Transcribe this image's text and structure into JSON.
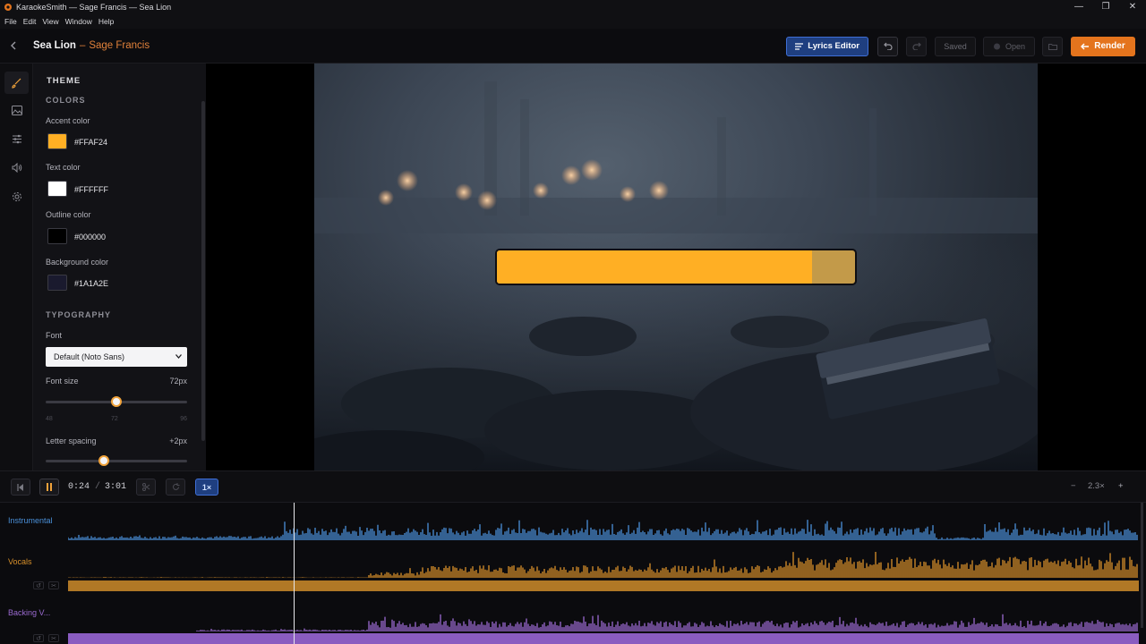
{
  "window": {
    "title": "KaraokeSmith — Sage Francis — Sea Lion",
    "controls": [
      "—",
      "❐",
      "✕"
    ]
  },
  "menu": [
    "File",
    "Edit",
    "View",
    "Window",
    "Help"
  ],
  "header": {
    "song_title": "Sea Lion",
    "separator": "–",
    "artist": "Sage Francis",
    "lyrics_editor_label": "Lyrics Editor",
    "saved_label": "Saved",
    "open_label": "Open",
    "render_label": "Render"
  },
  "theme_panel": {
    "title": "THEME",
    "colors_title": "COLORS",
    "accent_label": "Accent color",
    "accent_value": "#FFAF24",
    "text_label": "Text color",
    "text_value": "#FFFFFF",
    "outline_label": "Outline color",
    "outline_value": "#000000",
    "background_label": "Background color",
    "background_value": "#1A1A2E",
    "typography_title": "TYPOGRAPHY",
    "font_label": "Font",
    "font_value": "Default (Noto Sans)",
    "font_size_label": "Font size",
    "font_size_value": "72px",
    "font_size_min": "48",
    "font_size_mid": "72",
    "font_size_max": "96",
    "font_size_fraction": 0.5,
    "letter_spacing_label": "Letter spacing",
    "letter_spacing_value": "+2px",
    "letter_spacing_fraction": 0.41
  },
  "preview": {
    "lyric_progress": 0.88
  },
  "transport": {
    "current_time": "0:24",
    "separator": "/",
    "total_time": "3:01",
    "speed": "1×",
    "zoom_out": "−",
    "zoom_level": "2.3×",
    "zoom_in": "+"
  },
  "tracks": [
    {
      "name": "Instrumental",
      "color": "#4a90d9"
    },
    {
      "name": "Vocals",
      "color": "#d9902a"
    },
    {
      "name": "Backing V...",
      "color": "#9a6ad0"
    }
  ],
  "colors": {
    "accent": "#FFAF24",
    "render": "#e4741d",
    "primary": "#1f3f80"
  }
}
